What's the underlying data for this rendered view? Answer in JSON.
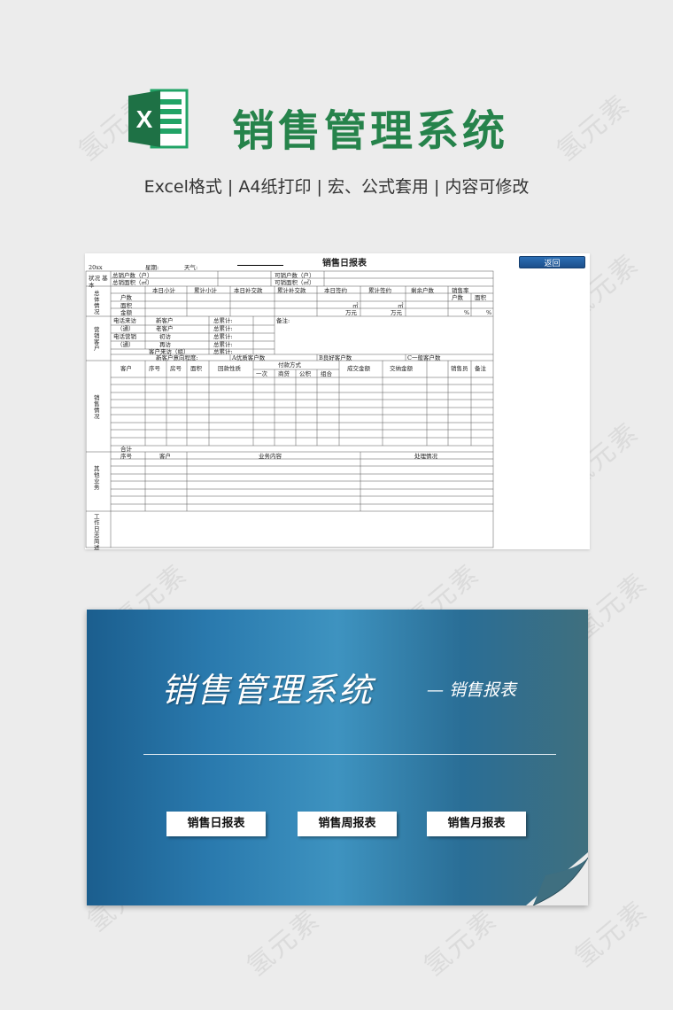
{
  "header": {
    "title": "销售管理系统",
    "subtitle": "Excel格式 |  A4纸打印 | 宏、公式套用 | 内容可修改",
    "logo_letter": "X",
    "brand_color": "#26834b"
  },
  "watermark": "氢元素",
  "sheet": {
    "title": "销售日报表",
    "back_button": "返回",
    "date_row": {
      "year": "20xx",
      "week": "星期:",
      "weather": "天气:"
    },
    "basic": {
      "label": "状况 基本",
      "total_households": "总销户数（户）",
      "total_area": "总销面积（㎡）",
      "available_households": "可销户数（户）",
      "available_area": "可销面积（㎡）"
    },
    "overall": {
      "label": "总体情况",
      "cols": [
        "本日小计",
        "累计小计",
        "本日补交款",
        "累计补交款",
        "本日签约",
        "累计签约",
        "剩余户数",
        "销售率"
      ],
      "rows": [
        "户数",
        "面积",
        "金额"
      ],
      "sub_cols": [
        "户数",
        "面积"
      ],
      "units": {
        "sqm": "㎡",
        "wan": "万元",
        "percent": "%"
      }
    },
    "marketing": {
      "label": "营销客户",
      "rows": [
        {
          "a": "电话来访",
          "b": "新客户",
          "c": "总累计:"
        },
        {
          "a": "（通）",
          "b": "老客户",
          "c": "总累计:"
        },
        {
          "a": "电话营销",
          "b": "初访",
          "c": "总累计:"
        },
        {
          "a": "（通）",
          "b": "再访",
          "c": "总累计:"
        },
        {
          "a": "",
          "b": "客户来访（组）",
          "c": "总累计:"
        }
      ],
      "note": "备注:",
      "intent_row": [
        "新客户意向程度:",
        "A优质客户数",
        "B良好客户数",
        "C一般客户数"
      ]
    },
    "sales": {
      "label": "销售情况",
      "cols": [
        "客户",
        "序号",
        "房号",
        "面积",
        "回款性质",
        "付款方式",
        "成交金额",
        "交纳金额",
        "销售员",
        "备注"
      ],
      "pay_sub": [
        "一次",
        "商贷",
        "公积",
        "组合"
      ],
      "total": "合计"
    },
    "other": {
      "label": "其他业务",
      "cols": [
        "序号",
        "客户",
        "业务内容",
        "处理情况"
      ]
    },
    "worklog": {
      "label": "工作日志简述"
    }
  },
  "banner": {
    "title": "销售管理系统",
    "subtitle": "— 销售报表",
    "buttons": [
      "销售日报表",
      "销售周报表",
      "销售月报表"
    ]
  }
}
